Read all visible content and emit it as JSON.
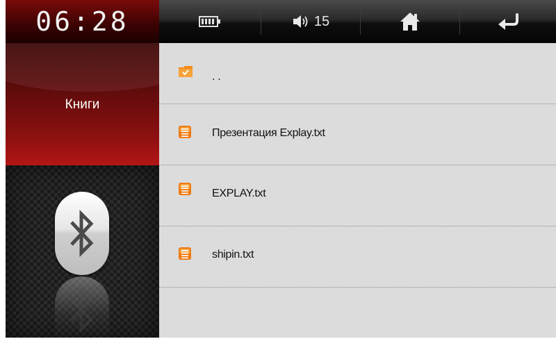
{
  "status": {
    "clock": "06:28",
    "volume": "15"
  },
  "panel": {
    "title": "Книги"
  },
  "files": [
    {
      "name": ". .",
      "icon": "folder-up-icon"
    },
    {
      "name": "Презентация Explay.txt",
      "icon": "text-file-icon"
    },
    {
      "name": "EXPLAY.txt",
      "icon": "text-file-icon"
    },
    {
      "name": "shipin.txt",
      "icon": "text-file-icon"
    }
  ],
  "icons": {
    "battery": "battery-icon",
    "volume": "speaker-icon",
    "home": "home-icon",
    "back": "back-arrow-icon",
    "bluetooth": "bluetooth-icon"
  },
  "colors": {
    "accent_red": "#b31616",
    "list_background": "#dcdcdc",
    "file_icon_orange": "#f07a10"
  }
}
